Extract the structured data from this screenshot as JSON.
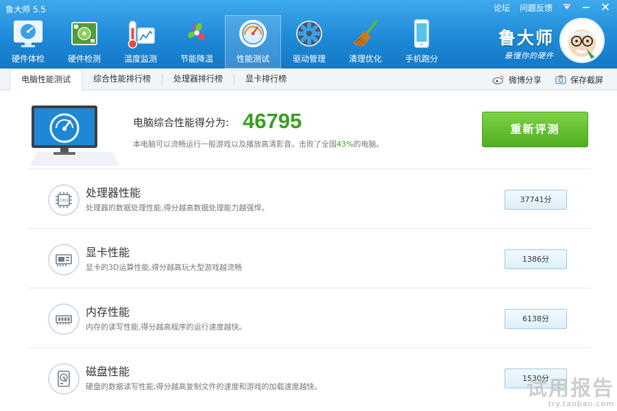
{
  "app": {
    "title": "鲁大师 5.5",
    "top_links": [
      "论坛",
      "问题反馈"
    ],
    "brand_name": "鲁大师",
    "brand_slogan": "最懂你的硬件"
  },
  "nav": {
    "items": [
      {
        "label": "硬件体检",
        "icon": "health-check-icon"
      },
      {
        "label": "硬件检测",
        "icon": "hardware-board-icon"
      },
      {
        "label": "温度监测",
        "icon": "thermometer-icon"
      },
      {
        "label": "节能降温",
        "icon": "fan-icon"
      },
      {
        "label": "性能测试",
        "icon": "speedometer-icon",
        "active": true
      },
      {
        "label": "驱动管理",
        "icon": "gear-icon"
      },
      {
        "label": "清理优化",
        "icon": "broom-icon"
      },
      {
        "label": "手机跑分",
        "icon": "phone-icon"
      }
    ]
  },
  "tabs": {
    "items": [
      "电脑性能测试",
      "综合性能排行榜",
      "处理器排行榜",
      "显卡排行榜"
    ],
    "active_index": 0,
    "actions": [
      {
        "label": "微博分享",
        "icon": "weibo-icon"
      },
      {
        "label": "保存截屏",
        "icon": "camera-icon"
      }
    ]
  },
  "summary": {
    "title": "电脑综合性能得分为:",
    "score": "46795",
    "desc_before": "本电脑可以流畅运行一般游戏以及播放高清影音。击败了全国",
    "desc_percent": "43%",
    "desc_after": "的电脑。",
    "retest_label": "重新评测"
  },
  "rows": [
    {
      "title": "处理器性能",
      "desc": "处理器的数据处理性能,得分越高数据处理能力越强悍。",
      "score": "37741分",
      "icon": "cpu-icon"
    },
    {
      "title": "显卡性能",
      "desc": "显卡的3D运算性能,得分越高玩大型游戏越流畅",
      "score": "1386分",
      "icon": "graphics-card-icon"
    },
    {
      "title": "内存性能",
      "desc": "内存的读写性能,得分越高程序的运行速度越快。",
      "score": "6138分",
      "icon": "memory-icon"
    },
    {
      "title": "磁盘性能",
      "desc": "硬盘的数据读写性能,得分越高复制文件的速度和游戏的加载速度越快。",
      "score": "1530分",
      "icon": "hard-disk-icon"
    }
  ],
  "watermark": {
    "text": "试用报告",
    "url": "try.taobao.com"
  },
  "colors": {
    "header_blue": "#1e8ad8",
    "score_green": "#3a9f1e",
    "button_green": "#4fae1f"
  }
}
